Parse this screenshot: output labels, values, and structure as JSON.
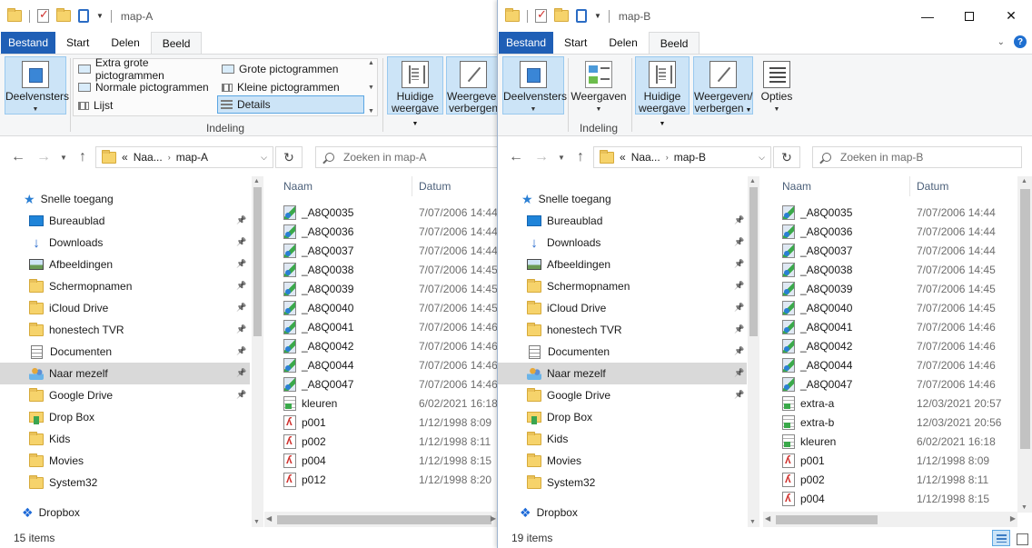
{
  "ribbon_tabs": [
    "Bestand",
    "Start",
    "Delen",
    "Beeld"
  ],
  "window_a": {
    "title": "map-A",
    "layout_options": {
      "extra_groot": "Extra grote pictogrammen",
      "groot": "Grote pictogrammen",
      "normaal": "Normale pictogrammen",
      "klein": "Kleine pictogrammen",
      "lijst": "Lijst",
      "details": "Details"
    },
    "ribbon": {
      "deelvensters": "Deelvensters",
      "indeling_label": "Indeling",
      "huidige_weergave_1": "Huidige",
      "huidige_weergave_2": "weergave",
      "weergeven_1": "Weergeven/",
      "weergeven_2": "verbergen"
    },
    "address": {
      "prefix": "«",
      "crumb1": "Naa...",
      "crumb2": "map-A"
    },
    "search_placeholder": "Zoeken in map-A",
    "status": "15 items"
  },
  "window_b": {
    "title": "map-B",
    "ribbon": {
      "deelvensters": "Deelvensters",
      "weergaven": "Weergaven",
      "indeling_label": "Indeling",
      "huidige_weergave_1": "Huidige",
      "huidige_weergave_2": "weergave",
      "weergeven_1": "Weergeven/",
      "weergeven_2": "verbergen",
      "opties": "Opties"
    },
    "address": {
      "prefix": "«",
      "crumb1": "Naa...",
      "crumb2": "map-B"
    },
    "search_placeholder": "Zoeken in map-B",
    "status": "19 items"
  },
  "nav": {
    "quick_access": "Snelle toegang",
    "items": [
      "Bureaublad",
      "Downloads",
      "Afbeeldingen",
      "Schermopnamen",
      "iCloud Drive",
      "honestech TVR",
      "Documenten",
      "Naar mezelf",
      "Google Drive",
      "Drop Box",
      "Kids",
      "Movies",
      "System32"
    ],
    "dropbox": "Dropbox"
  },
  "columns": {
    "name": "Naam",
    "date": "Datum"
  },
  "files_a": [
    {
      "name": "_A8Q0035",
      "date": "7/07/2006 14:44",
      "type": "img"
    },
    {
      "name": "_A8Q0036",
      "date": "7/07/2006 14:44",
      "type": "img"
    },
    {
      "name": "_A8Q0037",
      "date": "7/07/2006 14:44",
      "type": "img"
    },
    {
      "name": "_A8Q0038",
      "date": "7/07/2006 14:45",
      "type": "img"
    },
    {
      "name": "_A8Q0039",
      "date": "7/07/2006 14:45",
      "type": "img"
    },
    {
      "name": "_A8Q0040",
      "date": "7/07/2006 14:45",
      "type": "img"
    },
    {
      "name": "_A8Q0041",
      "date": "7/07/2006 14:46",
      "type": "img"
    },
    {
      "name": "_A8Q0042",
      "date": "7/07/2006 14:46",
      "type": "img"
    },
    {
      "name": "_A8Q0044",
      "date": "7/07/2006 14:46",
      "type": "img"
    },
    {
      "name": "_A8Q0047",
      "date": "7/07/2006 14:46",
      "type": "img"
    },
    {
      "name": "kleuren",
      "date": "6/02/2021 16:18",
      "type": "txtimg"
    },
    {
      "name": "p001",
      "date": "1/12/1998 8:09",
      "type": "pdf"
    },
    {
      "name": "p002",
      "date": "1/12/1998 8:11",
      "type": "pdf"
    },
    {
      "name": "p004",
      "date": "1/12/1998 8:15",
      "type": "pdf"
    },
    {
      "name": "p012",
      "date": "1/12/1998 8:20",
      "type": "pdf"
    }
  ],
  "files_b": [
    {
      "name": "_A8Q0035",
      "date": "7/07/2006 14:44",
      "type": "img"
    },
    {
      "name": "_A8Q0036",
      "date": "7/07/2006 14:44",
      "type": "img"
    },
    {
      "name": "_A8Q0037",
      "date": "7/07/2006 14:44",
      "type": "img"
    },
    {
      "name": "_A8Q0038",
      "date": "7/07/2006 14:45",
      "type": "img"
    },
    {
      "name": "_A8Q0039",
      "date": "7/07/2006 14:45",
      "type": "img"
    },
    {
      "name": "_A8Q0040",
      "date": "7/07/2006 14:45",
      "type": "img"
    },
    {
      "name": "_A8Q0041",
      "date": "7/07/2006 14:46",
      "type": "img"
    },
    {
      "name": "_A8Q0042",
      "date": "7/07/2006 14:46",
      "type": "img"
    },
    {
      "name": "_A8Q0044",
      "date": "7/07/2006 14:46",
      "type": "img"
    },
    {
      "name": "_A8Q0047",
      "date": "7/07/2006 14:46",
      "type": "img"
    },
    {
      "name": "extra-a",
      "date": "12/03/2021 20:57",
      "type": "txtimg"
    },
    {
      "name": "extra-b",
      "date": "12/03/2021 20:56",
      "type": "txtimg"
    },
    {
      "name": "kleuren",
      "date": "6/02/2021 16:18",
      "type": "txtimg"
    },
    {
      "name": "p001",
      "date": "1/12/1998 8:09",
      "type": "pdf"
    },
    {
      "name": "p002",
      "date": "1/12/1998 8:11",
      "type": "pdf"
    },
    {
      "name": "p004",
      "date": "1/12/1998 8:15",
      "type": "pdf"
    }
  ],
  "colors": {
    "file_tab": "#1f5fb6",
    "selection": "#cce4f7",
    "nav_selected": "#d9d9d9"
  }
}
